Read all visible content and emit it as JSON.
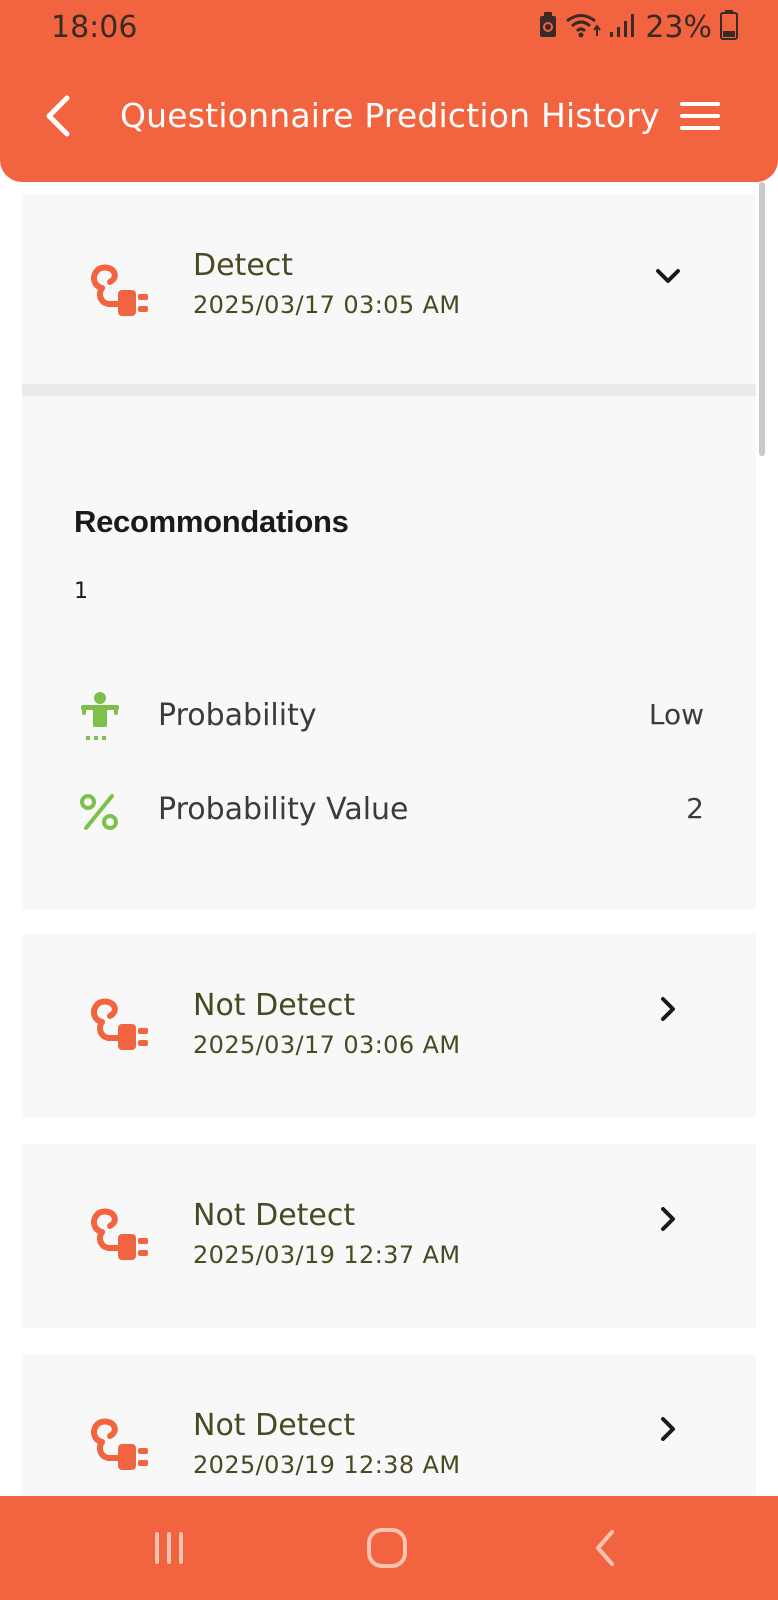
{
  "status_bar": {
    "time": "18:06",
    "battery": "23%"
  },
  "app_bar": {
    "title": "Questionnaire Prediction History"
  },
  "colors": {
    "brand": "#f26440",
    "icon_accent": "#f26440",
    "green": "#7cc24a",
    "card_bg": "#f8f8f8",
    "text_olive": "#4a4a22"
  },
  "history": [
    {
      "icon": "unplugged-icon",
      "result": "Detect",
      "datetime": "2025/03/17 03:05 AM",
      "expanded": true,
      "chevron": "chevron-down-icon",
      "details": {
        "recommendations_title": "Recommondations",
        "recommendation_value": "1",
        "probability_label": "Probability",
        "probability_value": "Low",
        "probability_icon": "person-standing-icon",
        "probability_value_label": "Probability Value",
        "probability_value_number": "2",
        "probability_value_icon": "percent-icon"
      }
    },
    {
      "icon": "unplugged-icon",
      "result": "Not Detect",
      "datetime": "2025/03/17 03:06 AM",
      "expanded": false,
      "chevron": "chevron-right-icon"
    },
    {
      "icon": "unplugged-icon",
      "result": "Not Detect",
      "datetime": "2025/03/19 12:37 AM",
      "expanded": false,
      "chevron": "chevron-right-icon"
    },
    {
      "icon": "unplugged-icon",
      "result": "Not Detect",
      "datetime": "2025/03/19 12:38 AM",
      "expanded": false,
      "chevron": "chevron-right-icon"
    }
  ],
  "nav_bar": {
    "recents": "recents-icon",
    "home": "home-icon",
    "back": "back-icon"
  }
}
